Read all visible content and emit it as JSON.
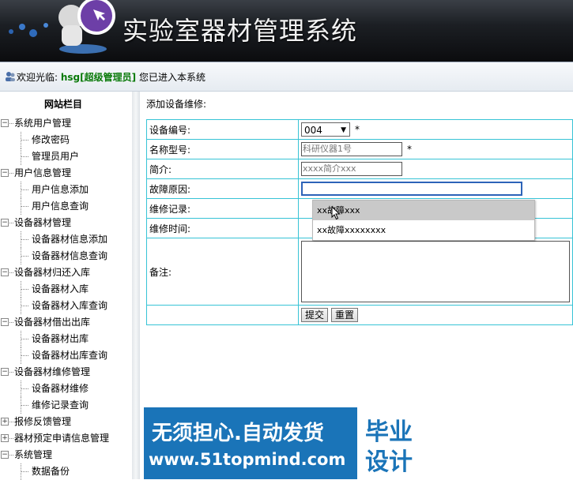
{
  "header": {
    "title": "实验室器材管理系统"
  },
  "welcome": {
    "prefix": "欢迎光临:",
    "username": "hsg",
    "role": "[超级管理员]",
    "suffix": "您已进入本系统"
  },
  "sidebar": {
    "title": "网站栏目",
    "tree": [
      {
        "type": "group",
        "label": "系统用户管理",
        "toggle": "−"
      },
      {
        "type": "leaf",
        "label": "修改密码"
      },
      {
        "type": "leaf",
        "label": "管理员用户"
      },
      {
        "type": "group",
        "label": "用户信息管理",
        "toggle": "−"
      },
      {
        "type": "leaf",
        "label": "用户信息添加"
      },
      {
        "type": "leaf",
        "label": "用户信息查询"
      },
      {
        "type": "group",
        "label": "设备器材管理",
        "toggle": "−"
      },
      {
        "type": "leaf",
        "label": "设备器材信息添加"
      },
      {
        "type": "leaf",
        "label": "设备器材信息查询"
      },
      {
        "type": "group",
        "label": "设备器材归还入库",
        "toggle": "−"
      },
      {
        "type": "leaf",
        "label": "设备器材入库"
      },
      {
        "type": "leaf",
        "label": "设备器材入库查询"
      },
      {
        "type": "group",
        "label": "设备器材借出出库",
        "toggle": "−"
      },
      {
        "type": "leaf",
        "label": "设备器材出库"
      },
      {
        "type": "leaf",
        "label": "设备器材出库查询"
      },
      {
        "type": "group",
        "label": "设备器材维修管理",
        "toggle": "−"
      },
      {
        "type": "leaf",
        "label": "设备器材维修"
      },
      {
        "type": "leaf",
        "label": "维修记录查询"
      },
      {
        "type": "group",
        "label": "报修反馈管理",
        "toggle": "+"
      },
      {
        "type": "group",
        "label": "器材预定申请信息管理",
        "toggle": "+"
      },
      {
        "type": "group",
        "label": "系统管理",
        "toggle": "−"
      },
      {
        "type": "leaf",
        "label": "数据备份"
      }
    ]
  },
  "main": {
    "caption": "添加设备维修:",
    "form": {
      "device_no_label": "设备编号:",
      "device_no_value": "004",
      "name_label": "名称型号:",
      "name_value": "科研仪器1号",
      "intro_label": "简介:",
      "intro_value": "xxxx简介xxx",
      "fault_label": "故障原因:",
      "fault_value": "",
      "record_label": "维修记录:",
      "time_label": "维修时间:",
      "remark_label": "备注:",
      "required_mark": "*",
      "submit_label": "提交",
      "reset_label": "重置"
    },
    "autocomplete": [
      "xx故障xxx",
      "xx故障xxxxxxxx"
    ]
  },
  "banner": {
    "line1": "无须担心.自动发货",
    "line2": "www.51topmind.com",
    "right1": "毕业",
    "right2": "设计"
  }
}
